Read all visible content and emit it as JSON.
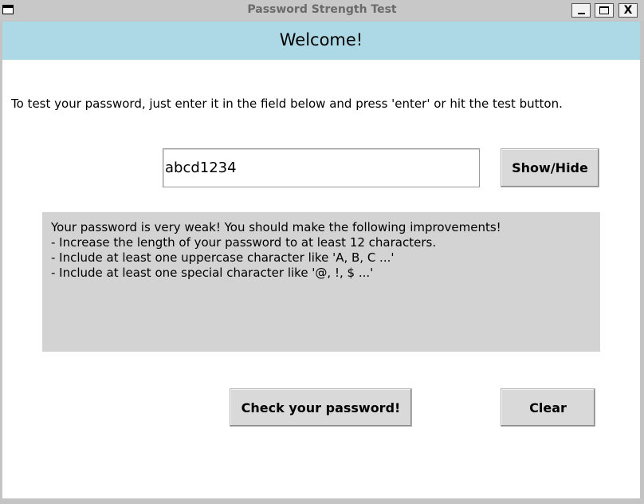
{
  "window": {
    "title": "Password Strength Test",
    "buttons": {
      "minimize_icon": "minimize-icon",
      "maximize_icon": "maximize-icon",
      "close_label": "X"
    }
  },
  "header": {
    "title": "Welcome!",
    "background": "#add8e6"
  },
  "instructions": "To test your password, just enter it in the field below and press 'enter' or hit the test button.",
  "password_field": {
    "value": "abcd1234"
  },
  "show_hide_label": "Show/Hide",
  "result": {
    "lines": [
      "Your password is very weak! You should make the following improvements!",
      "- Increase the length of your password to at least 12 characters.",
      "- Include at least one uppercase character like 'A, B, C ...'",
      "- Include at least one special character like '@, !, $ ...'"
    ],
    "background": "#d3d3d3"
  },
  "check_label": "Check your password!",
  "clear_label": "Clear"
}
